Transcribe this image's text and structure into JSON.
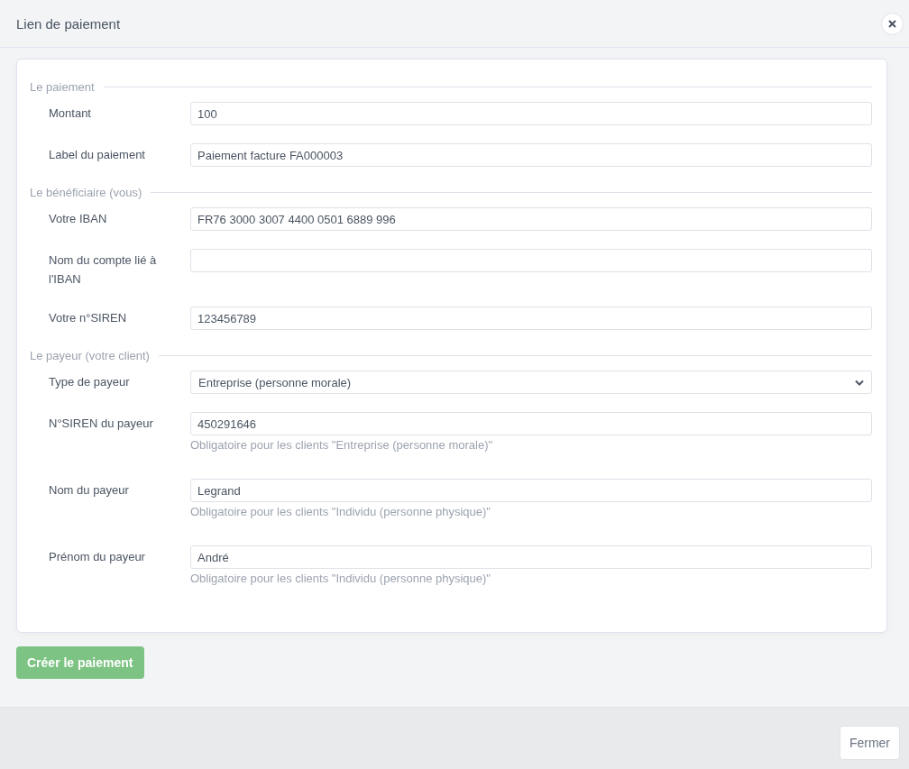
{
  "window": {
    "title": "Lien de paiement"
  },
  "sections": [
    {
      "title": "Le paiement",
      "fields": [
        {
          "kind": "text",
          "label": "Montant",
          "value": "100"
        },
        {
          "kind": "text",
          "label": "Label du paiement",
          "value": "Paiement facture FA000003"
        }
      ]
    },
    {
      "title": "Le bénéficiaire (vous)",
      "fields": [
        {
          "kind": "text",
          "label": "Votre IBAN",
          "value": "FR76 3000 3007 4400 0501 6889 996"
        },
        {
          "kind": "text",
          "label": "Nom du compte lié à l'IBAN"
        },
        {
          "kind": "text",
          "label": "Votre n°SIREN",
          "value": "123456789"
        }
      ]
    },
    {
      "title": "Le payeur (votre client)",
      "fields": [
        {
          "kind": "select",
          "label": "Type de payeur",
          "value": "Entreprise (personne morale)"
        },
        {
          "kind": "text",
          "label": "N°SIREN du payeur",
          "value": "450291646",
          "help": "Obligatoire pour les clients \"Entreprise (personne morale)\""
        },
        {
          "kind": "text",
          "label": "Nom du payeur",
          "value": "Legrand",
          "help": "Obligatoire pour les clients \"Individu (personne physique)\""
        },
        {
          "kind": "text",
          "label": "Prénom du payeur",
          "value": "André",
          "help": "Obligatoire pour les clients \"Individu (personne physique)\""
        }
      ]
    }
  ],
  "submit_button": "Créer le paiement",
  "footer": {
    "close_button": "Fermer"
  }
}
